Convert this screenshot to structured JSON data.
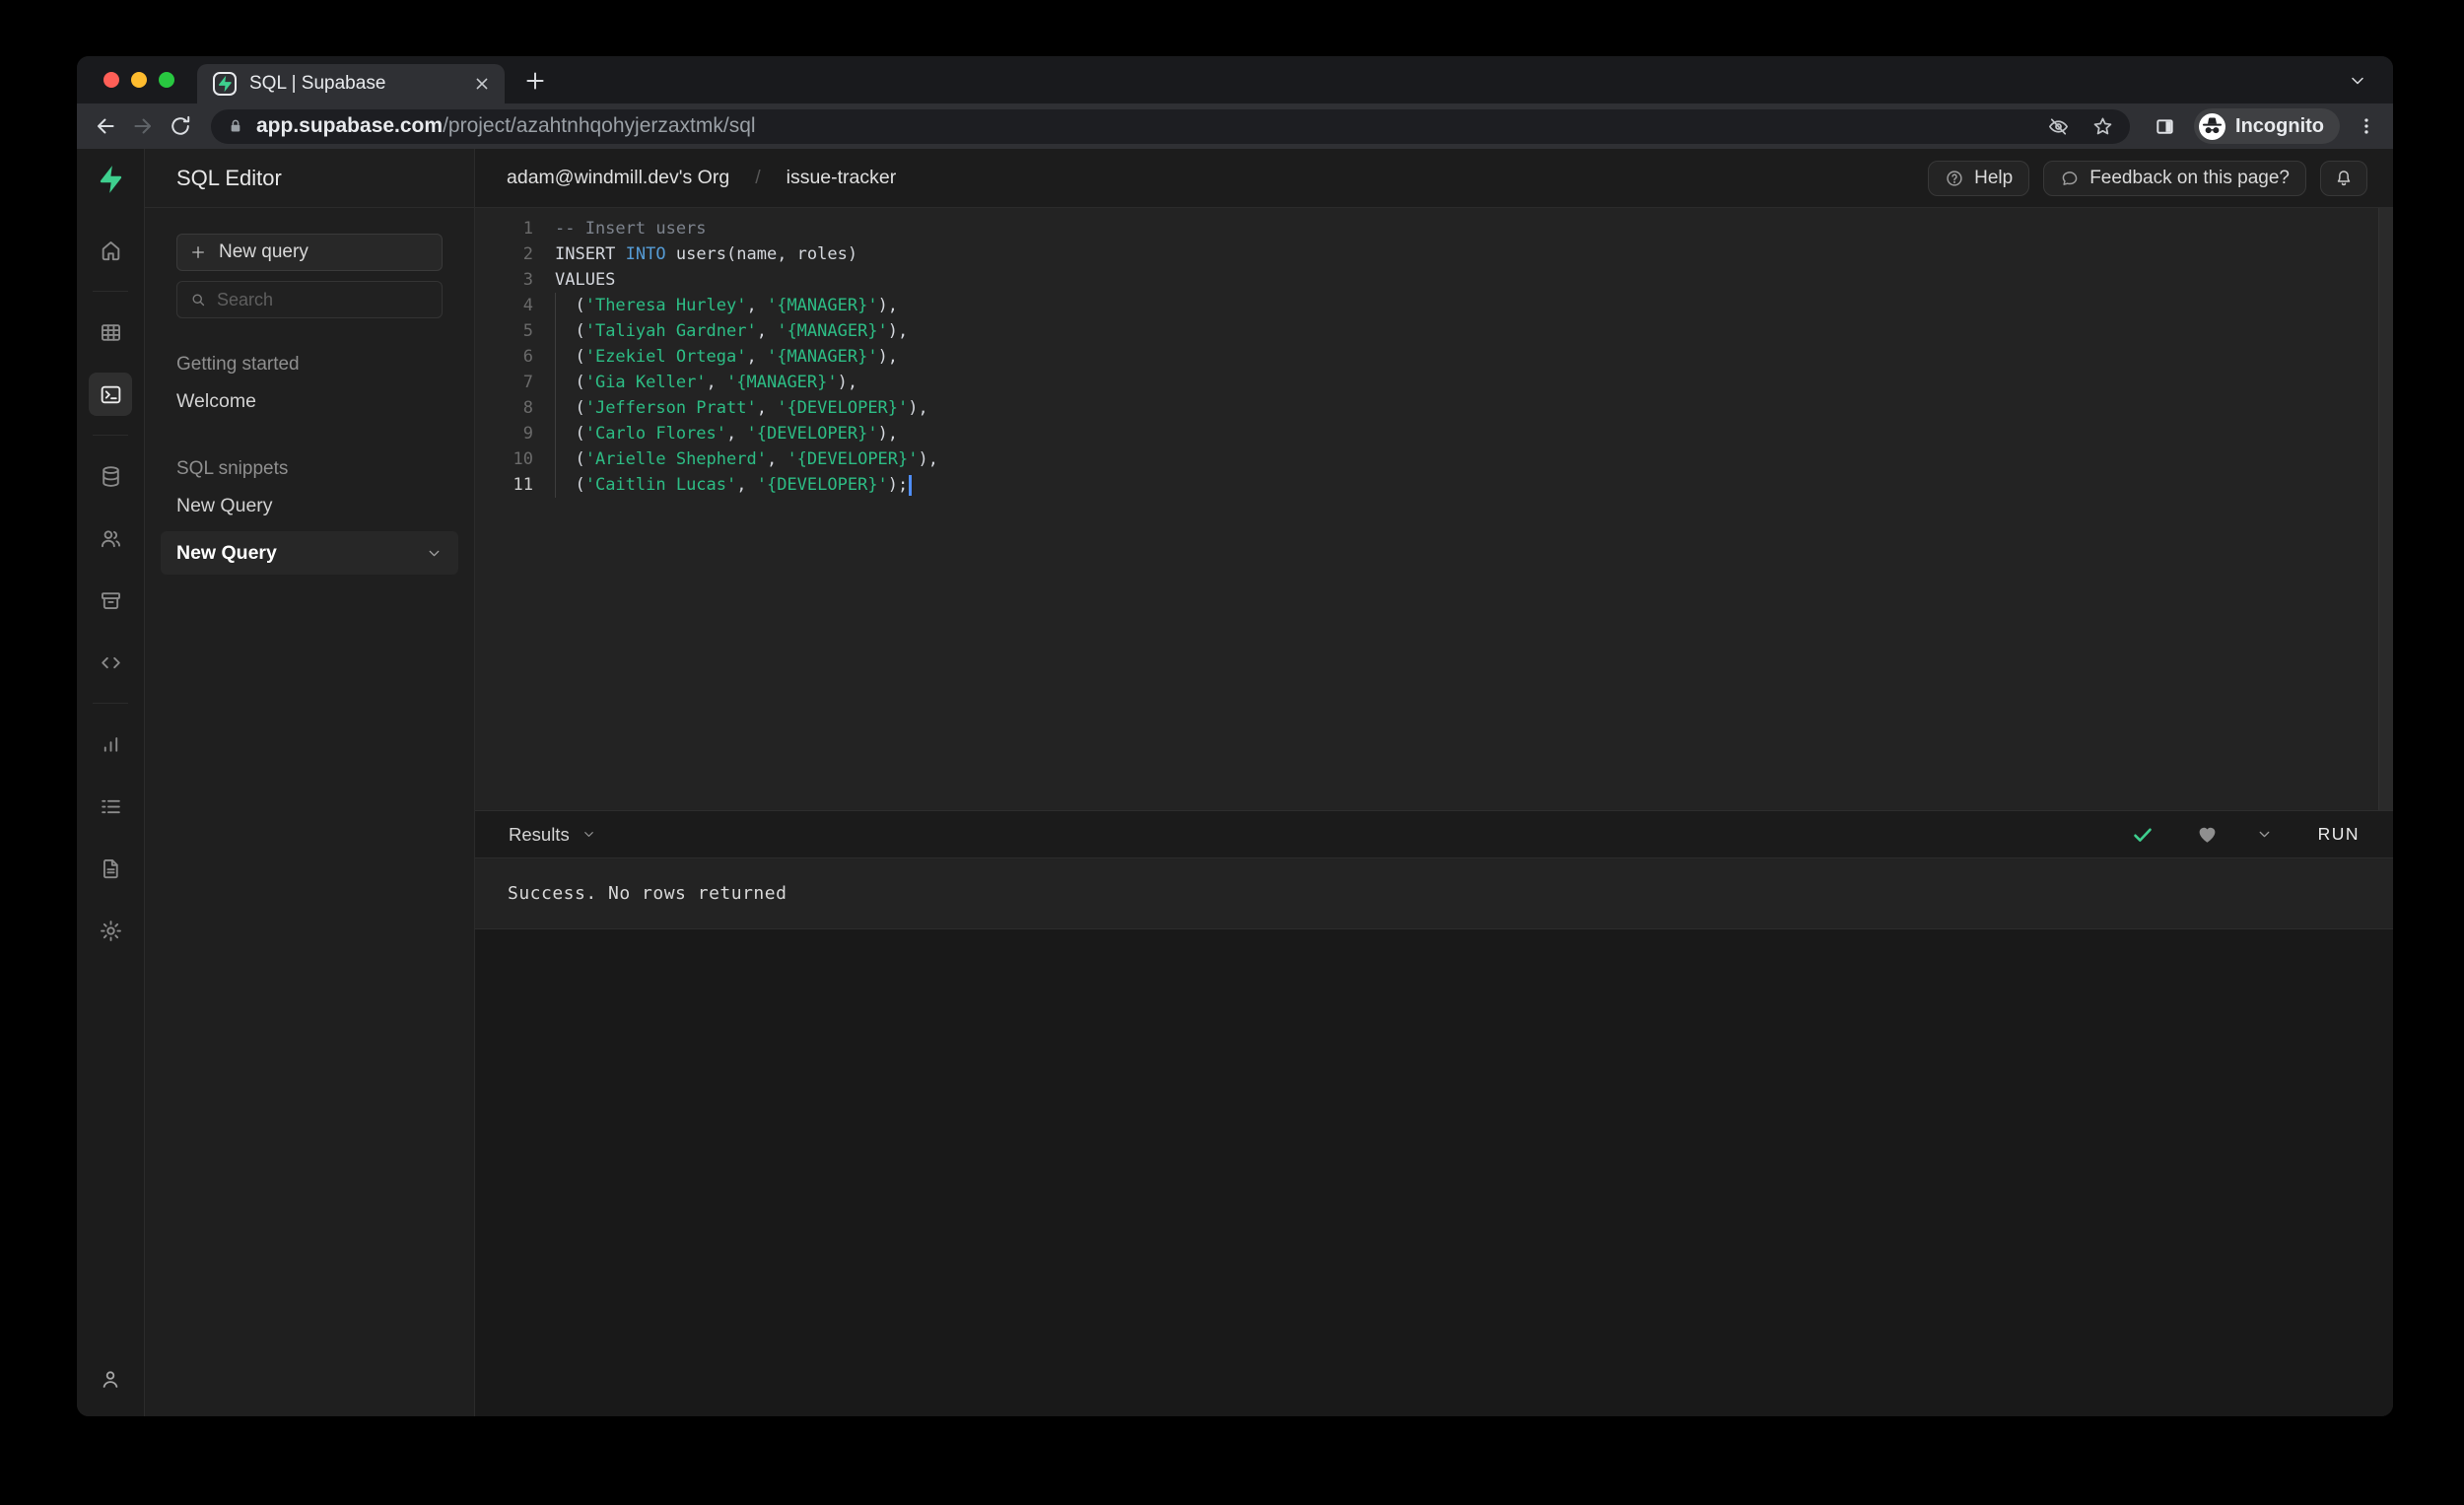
{
  "browser": {
    "tab_title": "SQL | Supabase",
    "url_domain": "app.supabase.com",
    "url_path": "/project/azahtnhqohyjerzaxtmk/sql",
    "incognito_label": "Incognito"
  },
  "header": {
    "breadcrumb_org": "adam@windmill.dev's Org",
    "breadcrumb_separator": "/",
    "breadcrumb_project": "issue-tracker",
    "help_label": "Help",
    "feedback_label": "Feedback on this page?"
  },
  "rail": {
    "items": [
      {
        "icon": "home-icon"
      },
      {
        "divider": true
      },
      {
        "icon": "table-editor-icon"
      },
      {
        "icon": "sql-editor-icon",
        "selected": true
      },
      {
        "divider": true
      },
      {
        "icon": "database-icon"
      },
      {
        "icon": "auth-users-icon"
      },
      {
        "icon": "storage-icon"
      },
      {
        "icon": "edge-functions-icon"
      },
      {
        "divider": true
      },
      {
        "icon": "reports-icon"
      },
      {
        "icon": "logs-icon"
      },
      {
        "icon": "api-docs-icon"
      },
      {
        "icon": "settings-icon"
      }
    ],
    "bottom_icon": "account-icon"
  },
  "sidebar": {
    "title": "SQL Editor",
    "new_query_label": "New query",
    "search_placeholder": "Search",
    "sections": [
      {
        "label": "Getting started",
        "items": [
          {
            "label": "Welcome",
            "selected": false
          }
        ]
      },
      {
        "label": "SQL snippets",
        "items": [
          {
            "label": "New Query",
            "selected": false
          },
          {
            "label": "New Query",
            "selected": true
          }
        ]
      }
    ]
  },
  "editor": {
    "lines": [
      {
        "num": 1,
        "tokens": [
          [
            "comment",
            "-- Insert users"
          ]
        ]
      },
      {
        "num": 2,
        "tokens": [
          [
            "plain",
            "INSERT "
          ],
          [
            "kw",
            "INTO"
          ],
          [
            "plain",
            " users(name, roles)"
          ]
        ]
      },
      {
        "num": 3,
        "tokens": [
          [
            "plain",
            "VALUES"
          ]
        ]
      },
      {
        "num": 4,
        "tokens": [
          [
            "plain",
            "  ("
          ],
          [
            "str",
            "'Theresa Hurley'"
          ],
          [
            "plain",
            ", "
          ],
          [
            "str",
            "'{MANAGER}'"
          ],
          [
            "plain",
            "),"
          ]
        ]
      },
      {
        "num": 5,
        "tokens": [
          [
            "plain",
            "  ("
          ],
          [
            "str",
            "'Taliyah Gardner'"
          ],
          [
            "plain",
            ", "
          ],
          [
            "str",
            "'{MANAGER}'"
          ],
          [
            "plain",
            "),"
          ]
        ]
      },
      {
        "num": 6,
        "tokens": [
          [
            "plain",
            "  ("
          ],
          [
            "str",
            "'Ezekiel Ortega'"
          ],
          [
            "plain",
            ", "
          ],
          [
            "str",
            "'{MANAGER}'"
          ],
          [
            "plain",
            "),"
          ]
        ]
      },
      {
        "num": 7,
        "tokens": [
          [
            "plain",
            "  ("
          ],
          [
            "str",
            "'Gia Keller'"
          ],
          [
            "plain",
            ", "
          ],
          [
            "str",
            "'{MANAGER}'"
          ],
          [
            "plain",
            "),"
          ]
        ]
      },
      {
        "num": 8,
        "tokens": [
          [
            "plain",
            "  ("
          ],
          [
            "str",
            "'Jefferson Pratt'"
          ],
          [
            "plain",
            ", "
          ],
          [
            "str",
            "'{DEVELOPER}'"
          ],
          [
            "plain",
            "),"
          ]
        ]
      },
      {
        "num": 9,
        "tokens": [
          [
            "plain",
            "  ("
          ],
          [
            "str",
            "'Carlo Flores'"
          ],
          [
            "plain",
            ", "
          ],
          [
            "str",
            "'{DEVELOPER}'"
          ],
          [
            "plain",
            "),"
          ]
        ]
      },
      {
        "num": 10,
        "tokens": [
          [
            "plain",
            "  ("
          ],
          [
            "str",
            "'Arielle Shepherd'"
          ],
          [
            "plain",
            ", "
          ],
          [
            "str",
            "'{DEVELOPER}'"
          ],
          [
            "plain",
            "),"
          ]
        ]
      },
      {
        "num": 11,
        "tokens": [
          [
            "plain",
            "  ("
          ],
          [
            "str",
            "'Caitlin Lucas'"
          ],
          [
            "plain",
            ", "
          ],
          [
            "str",
            "'{DEVELOPER}'"
          ],
          [
            "plain",
            ");"
          ]
        ],
        "cursor": true,
        "active": true
      }
    ]
  },
  "results": {
    "label": "Results",
    "run_label": "RUN",
    "message": "Success. No rows returned"
  },
  "colors": {
    "accent_green": "#3ecf8e",
    "keyword_blue": "#569cd6",
    "string_green": "#2dbd85",
    "check_green": "#3ecf8e",
    "heart_gray": "#8f8f8f"
  }
}
